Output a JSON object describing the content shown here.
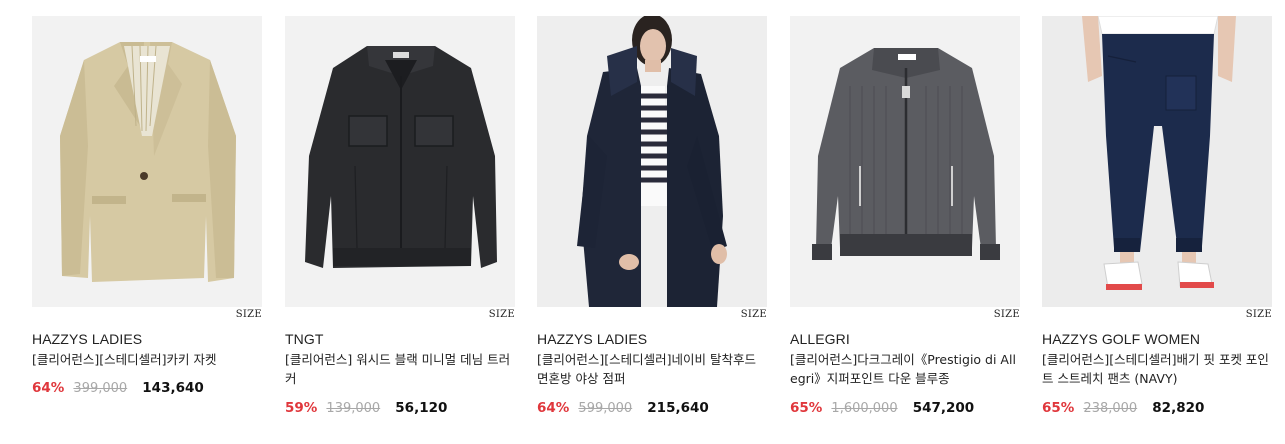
{
  "size_label": "SIZE",
  "products": [
    {
      "brand": "HAZZYS LADIES",
      "title": "[클리어런스][스테디셀러]카키 자켓",
      "discount": "64%",
      "original_price": "399,000",
      "final_price": "143,640",
      "image": "beige-blazer-icon",
      "color": "#d8cba6"
    },
    {
      "brand": "TNGT",
      "title": "[클리어런스] 워시드 블랙 미니멀 데님 트러커",
      "discount": "59%",
      "original_price": "139,000",
      "final_price": "56,120",
      "image": "black-denim-jacket-icon",
      "color": "#2b2c2f"
    },
    {
      "brand": "HAZZYS LADIES",
      "title": "[클리어런스][스테디셀러]네이비 탈착후드 면혼방 야상 점퍼",
      "discount": "64%",
      "original_price": "599,000",
      "final_price": "215,640",
      "image": "navy-hooded-parka-icon",
      "color": "#1f2638"
    },
    {
      "brand": "ALLEGRI",
      "title": "[클리어런스]다크그레이《Prestigio di Allegri》지퍼포인트 다운 블루종",
      "discount": "65%",
      "original_price": "1,600,000",
      "final_price": "547,200",
      "image": "grey-zip-blouson-icon",
      "color": "#5a5b5f"
    },
    {
      "brand": "HAZZYS GOLF WOMEN",
      "title": "[클리어런스][스테디셀러]배기 핏 포켓 포인트 스트레치 팬츠 (NAVY)",
      "discount": "65%",
      "original_price": "238,000",
      "final_price": "82,820",
      "image": "navy-pants-icon",
      "color": "#1b2a4a"
    }
  ]
}
